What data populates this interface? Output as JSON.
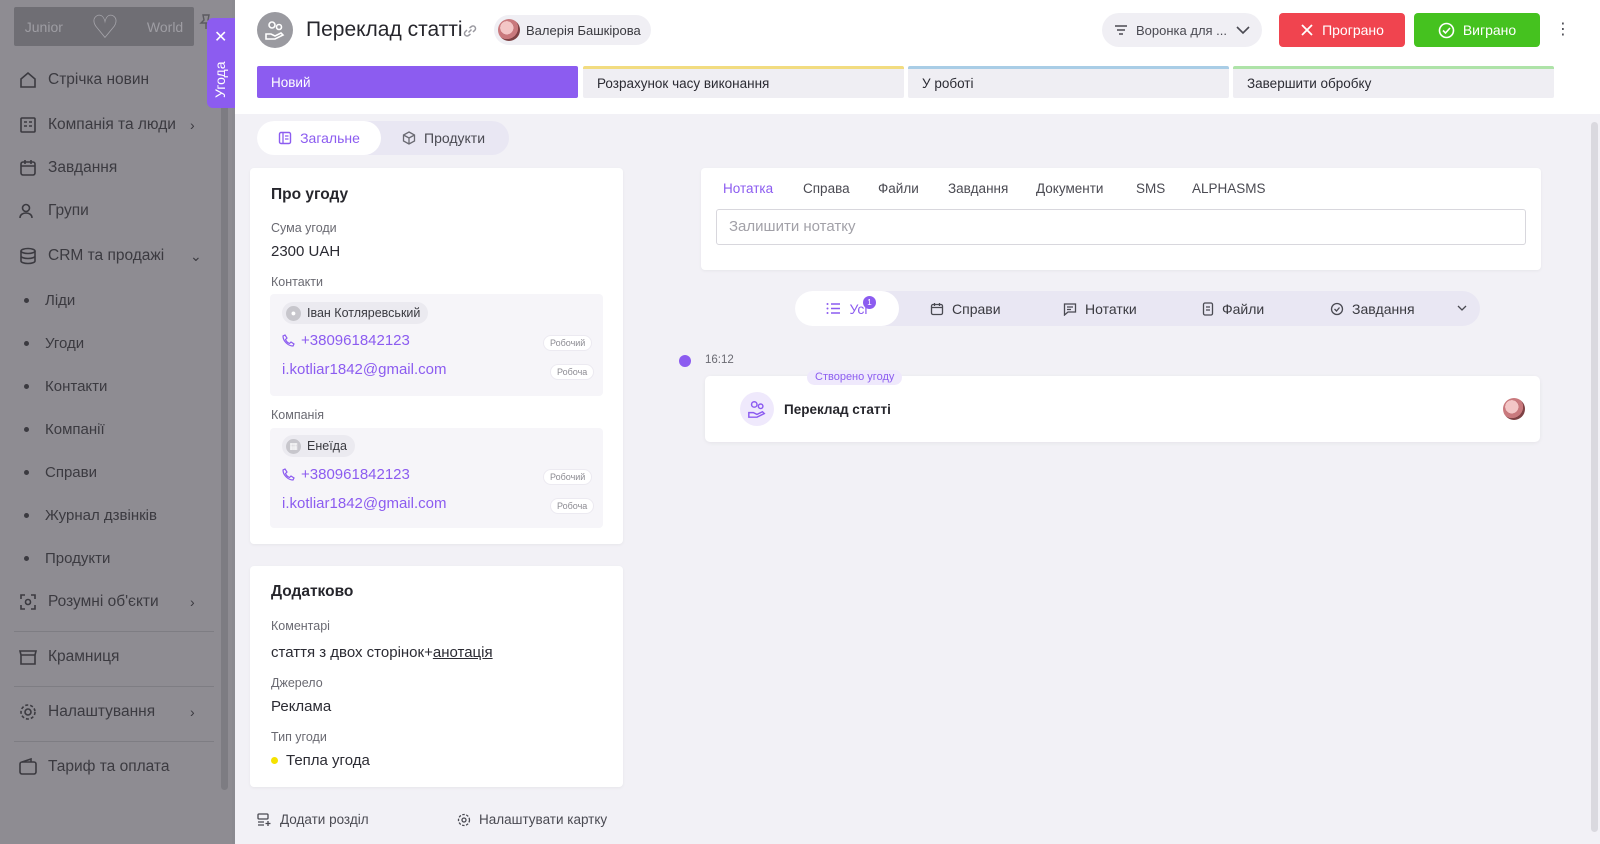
{
  "sidebar": {
    "logo_left": "Junior",
    "logo_right": "World",
    "items": [
      {
        "label": "Стрічка новин",
        "icon": "home-icon"
      },
      {
        "label": "Компанія та люди",
        "icon": "building-icon"
      },
      {
        "label": "Завдання",
        "icon": "calendar-icon"
      },
      {
        "label": "Групи",
        "icon": "group-icon"
      },
      {
        "label": "CRM та продажі",
        "icon": "database-icon"
      },
      {
        "label": "Розумні об'єкти",
        "icon": "smart-object-icon"
      },
      {
        "label": "Крамниця",
        "icon": "store-icon"
      },
      {
        "label": "Налаштування",
        "icon": "gear-icon"
      },
      {
        "label": "Тариф та оплата",
        "icon": "wallet-icon"
      }
    ],
    "crm_sub": [
      "Ліди",
      "Угоди",
      "Контакти",
      "Компанії",
      "Справи",
      "Журнал дзвінків",
      "Продукти"
    ]
  },
  "side_tab": {
    "label": "Угода"
  },
  "header": {
    "title": "Переклад статті",
    "owner": "Валерія Башкірова",
    "funnel": "Воронка для ...",
    "lost_label": "Програно",
    "won_label": "Виграно"
  },
  "stages": [
    {
      "label": "Новий"
    },
    {
      "label": "Розрахунок часу виконання"
    },
    {
      "label": "У роботі"
    },
    {
      "label": "Завершити обробку"
    }
  ],
  "tabs": {
    "general": "Загальне",
    "products": "Продукти"
  },
  "about": {
    "title": "Про угоду",
    "amount_label": "Сума угоди",
    "amount_value": "2300 UAH",
    "contacts_label": "Контакти",
    "contact": {
      "name": "Іван Котляревський",
      "phone": "+380961842123",
      "phone_tag": "Робочий",
      "email": "i.kotliar1842@gmail.com",
      "email_tag": "Робоча"
    },
    "company_label": "Компанія",
    "company": {
      "name": "Енеїда",
      "phone": "+380961842123",
      "phone_tag": "Робочий",
      "email": "i.kotliar1842@gmail.com",
      "email_tag": "Робоча"
    }
  },
  "extra": {
    "title": "Додатково",
    "comments_label": "Коментарі",
    "comments_text": "стаття з двох сторінок+",
    "comments_link": "анотація",
    "source_label": "Джерело",
    "source_value": "Реклама",
    "type_label": "Тип угоди",
    "type_value": "Тепла угода",
    "type_color": "#f5e200"
  },
  "note_panel": {
    "tabs": [
      "Нотатка",
      "Справа",
      "Файли",
      "Завдання",
      "Документи",
      "SMS",
      "ALPHASMS"
    ],
    "placeholder": "Залишити нотатку"
  },
  "filters": {
    "items": [
      "Усі",
      "Справи",
      "Нотатки",
      "Файли",
      "Завдання"
    ],
    "badge": "1"
  },
  "timeline": {
    "time": "16:12",
    "badge": "Створено угоду",
    "title": "Переклад статті"
  },
  "bottom": {
    "add_section": "Додати розділ",
    "configure_card": "Налаштувати картку"
  },
  "colors": {
    "accent": "#8c5cf0",
    "lost": "#f0444f",
    "won": "#45c21f"
  }
}
